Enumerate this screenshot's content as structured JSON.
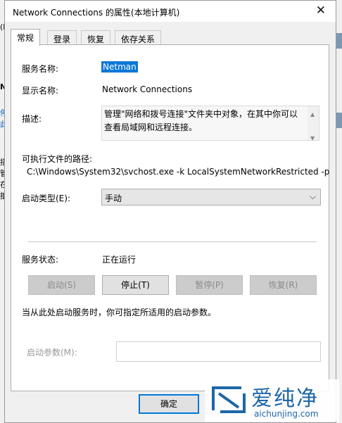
{
  "window": {
    "title": "Network Connections 的属性(本地计算机)",
    "close_glyph": "✕"
  },
  "tabs": [
    {
      "label": "常规",
      "active": true
    },
    {
      "label": "登录",
      "active": false
    },
    {
      "label": "恢复",
      "active": false
    },
    {
      "label": "依存关系",
      "active": false
    }
  ],
  "general": {
    "service_name_label": "服务名称:",
    "service_name_value": "Netman",
    "display_name_label": "显示名称:",
    "display_name_value": "Network Connections",
    "description_label": "描述:",
    "description_value": "管理\"网络和拨号连接\"文件夹中对象，在其中你可以查看局域网和远程连接。",
    "exe_path_label": "可执行文件的路径:",
    "exe_path_value": "C:\\Windows\\System32\\svchost.exe -k LocalSystemNetworkRestricted -p",
    "startup_type_label": "启动类型(E):",
    "startup_type_value": "手动",
    "service_status_label": "服务状态:",
    "service_status_value": "正在运行",
    "buttons": {
      "start": "启动(S)",
      "stop": "停止(T)",
      "pause": "暂停(P)",
      "resume": "恢复(R)"
    },
    "hint": "当从此处启动服务时，你可指定所适用的启动参数。",
    "start_params_label": "启动参数(M):",
    "start_params_value": ""
  },
  "footer": {
    "ok_label": "确定"
  },
  "background": {
    "left_glyphs": [
      "(k",
      "N",
      "停",
      "此",
      "描",
      "管",
      "在",
      "擅"
    ]
  },
  "watermark": {
    "name": "爱纯净",
    "url": "aichunjing.com"
  },
  "colors": {
    "selection": "#0a78d7",
    "ok_border": "#0078d7",
    "watermark": "#1d66a8"
  }
}
